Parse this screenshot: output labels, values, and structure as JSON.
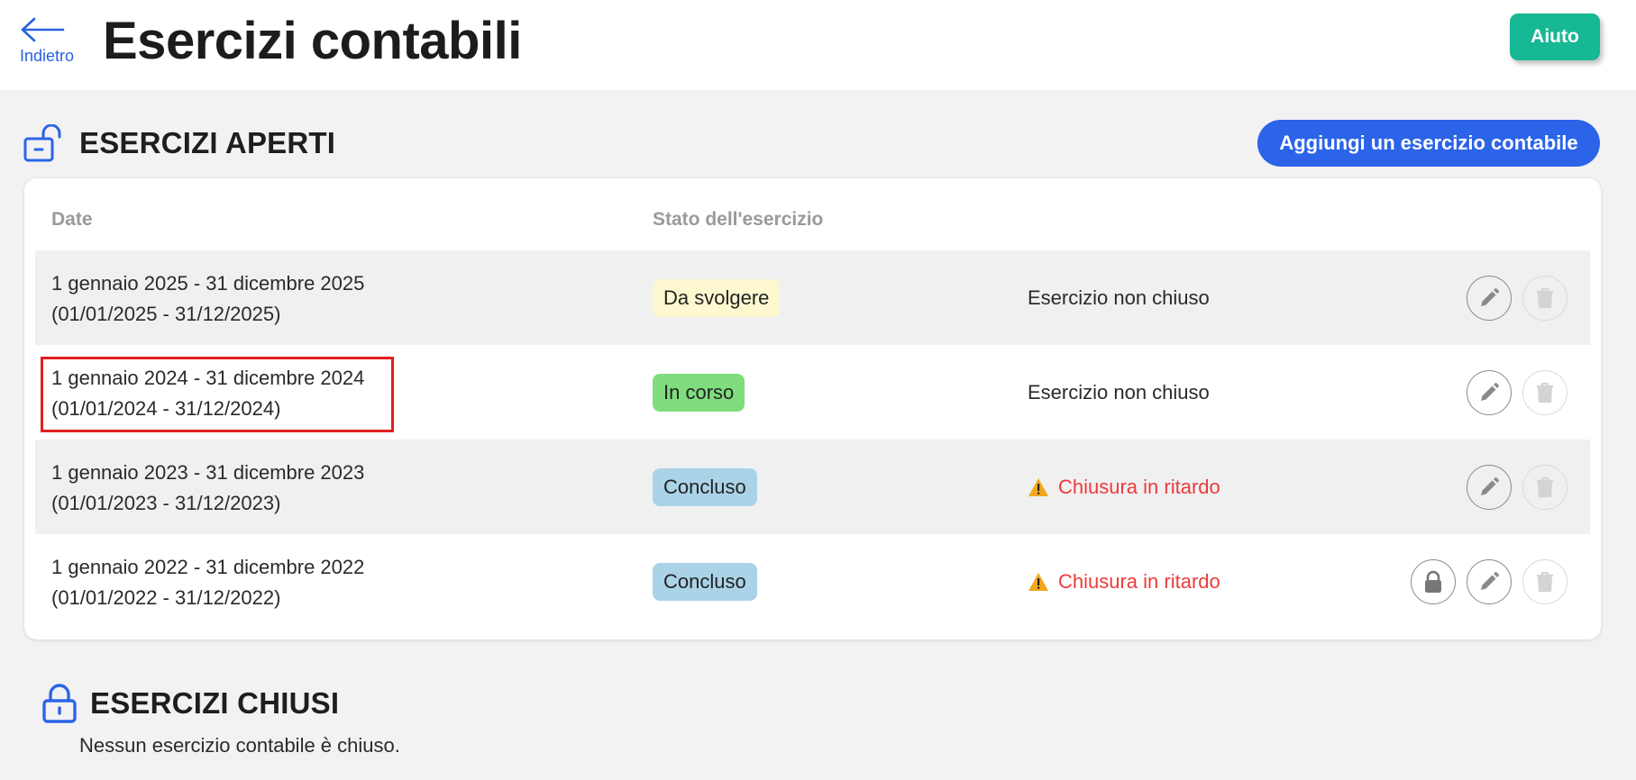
{
  "header": {
    "back_label": "Indietro",
    "title": "Esercizi contabili",
    "help_label": "Aiuto"
  },
  "open_section": {
    "title": "ESERCIZI APERTI",
    "add_label": "Aggiungi un esercizio contabile",
    "columns": [
      "Date",
      "Stato dell'esercizio"
    ],
    "rows": [
      {
        "range": "1 gennaio 2025 - 31 dicembre 2025",
        "range_short": "(01/01/2025 - 31/12/2025)",
        "badge": "Da svolgere",
        "status": "Esercizio non chiuso"
      },
      {
        "range": "1 gennaio 2024 - 31 dicembre 2024",
        "range_short": "(01/01/2024 - 31/12/2024)",
        "badge": "In corso",
        "status": "Esercizio non chiuso"
      },
      {
        "range": "1 gennaio 2023 - 31 dicembre 2023",
        "range_short": "(01/01/2023 - 31/12/2023)",
        "badge": "Concluso",
        "status": "Chiusura in ritardo"
      },
      {
        "range": "1 gennaio 2022 - 31 dicembre 2022",
        "range_short": "(01/01/2022 - 31/12/2022)",
        "badge": "Concluso",
        "status": "Chiusura in ritardo"
      }
    ]
  },
  "closed_section": {
    "title": "ESERCIZI CHIUSI",
    "empty_text": "Nessun esercizio contabile è chiuso."
  },
  "colors": {
    "primary_blue": "#2b64e8",
    "help_green": "#17b894",
    "late_red": "#ec3b3b",
    "badge_todo": "#fdf8cf",
    "badge_in_progress": "#7fdd7e",
    "badge_done": "#aad3e8"
  },
  "icons": [
    "back-arrow-icon",
    "unlock-icon",
    "lock-icon",
    "pencil-icon",
    "trash-icon",
    "warning-icon"
  ]
}
